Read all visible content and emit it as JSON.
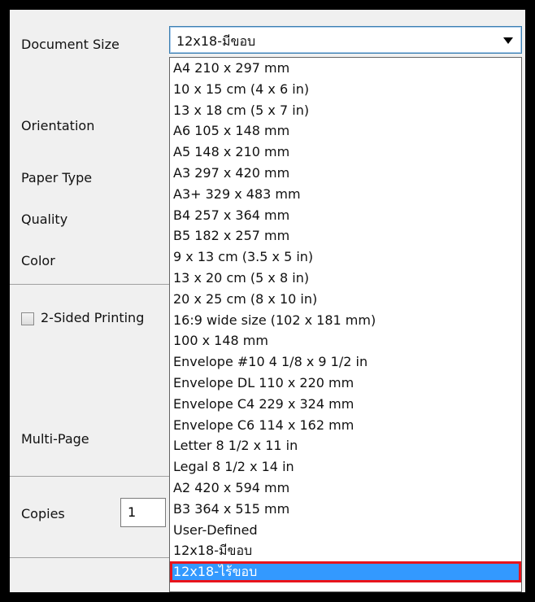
{
  "labels": {
    "document_size": "Document Size",
    "orientation": "Orientation",
    "paper_type": "Paper Type",
    "quality": "Quality",
    "color": "Color",
    "two_sided": "2-Sided Printing",
    "multi_page": "Multi-Page",
    "copies": "Copies"
  },
  "copies_value": "1",
  "document_size_selected": "12x18-มีขอบ",
  "document_size_options": [
    "A4 210 x 297 mm",
    "10 x 15 cm (4 x 6 in)",
    "13 x 18 cm (5 x 7 in)",
    "A6 105 x 148 mm",
    "A5 148 x 210 mm",
    "A3 297 x 420 mm",
    "A3+ 329 x 483 mm",
    "B4 257 x 364 mm",
    "B5 182 x 257 mm",
    "9 x 13 cm (3.5 x 5 in)",
    "13 x 20 cm (5 x 8 in)",
    "20 x 25 cm (8 x 10 in)",
    "16:9 wide size (102 x 181 mm)",
    "100 x 148 mm",
    "Envelope #10 4 1/8 x 9 1/2 in",
    "Envelope DL  110 x 220 mm",
    "Envelope C4  229 x 324 mm",
    "Envelope C6  114 x 162 mm",
    "Letter 8 1/2 x 11 in",
    "Legal 8 1/2 x 14 in",
    "A2 420 x 594 mm",
    "B3 364 x 515 mm",
    "User-Defined",
    "12x18-มีขอบ",
    "12x18-ไร้ขอบ"
  ],
  "highlighted_option": "12x18-ไร้ขอบ",
  "colors": {
    "highlight": "#3399ff",
    "annotation_border": "#e8141c",
    "panel": "#f0f0f0"
  }
}
